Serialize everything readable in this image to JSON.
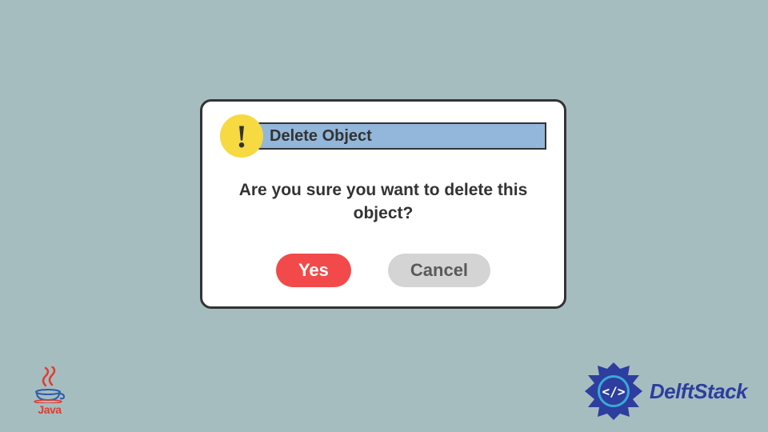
{
  "dialog": {
    "title": "Delete Object",
    "message": "Are you sure you want to delete this object?",
    "yes_label": "Yes",
    "cancel_label": "Cancel"
  },
  "logos": {
    "java": "Java",
    "delftstack": "DelftStack"
  }
}
